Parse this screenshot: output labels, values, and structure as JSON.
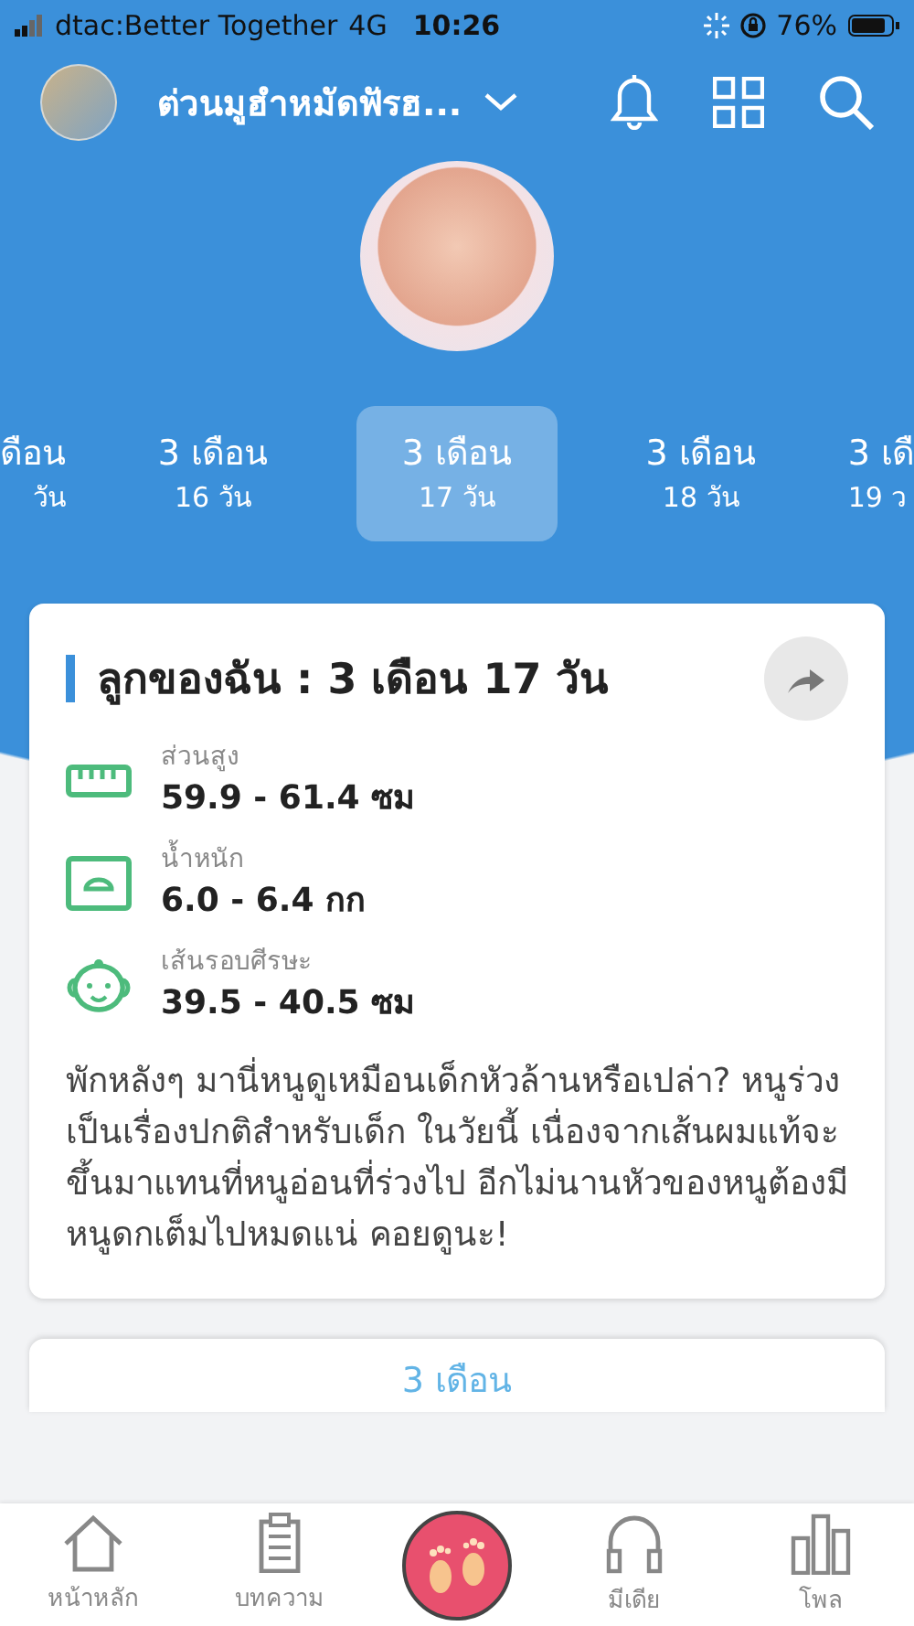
{
  "status_bar": {
    "carrier": "dtac:Better Together",
    "network": "4G",
    "time": "10:26",
    "battery": "76%"
  },
  "header": {
    "title": "ต่วนมูฮำหมัดฟัรฮ..."
  },
  "age_tabs": [
    {
      "top": "ดือน",
      "bottom": "วัน",
      "selected": false
    },
    {
      "top": "3 เดือน",
      "bottom": "16 วัน",
      "selected": false
    },
    {
      "top": "3 เดือน",
      "bottom": "17 วัน",
      "selected": true
    },
    {
      "top": "3 เดือน",
      "bottom": "18 วัน",
      "selected": false
    },
    {
      "top": "3 เดื",
      "bottom": "19 ว",
      "selected": false
    }
  ],
  "card": {
    "title": "ลูกของฉัน : 3 เดือน 17 วัน",
    "metrics": [
      {
        "label": "ส่วนสูง",
        "value": "59.9 - 61.4 ซม"
      },
      {
        "label": "น้ำหนัก",
        "value": "6.0 - 6.4 กก"
      },
      {
        "label": "เส้นรอบศีรษะ",
        "value": "39.5 - 40.5 ซม"
      }
    ],
    "text": "พักหลังๆ มานี่หนูดูเหมือนเด็กหัวล้านหรือเปล่า? หนูร่วงเป็นเรื่องปกติสำหรับเด็ก ในวัยนี้ เนื่องจากเส้นผมแท้จะขึ้นมาแทนที่หนูอ่อนที่ร่วงไป อีกไม่นานหัวของหนูต้องมีหนูดกเต็มไปหมดแน่ คอยดูนะ!"
  },
  "next_card": {
    "title": "3 เดือน"
  },
  "bottom_nav": [
    {
      "kind": "link",
      "label": "หน้าหลัก"
    },
    {
      "kind": "link",
      "label": "บทความ"
    },
    {
      "kind": "center"
    },
    {
      "kind": "link",
      "label": "มีเดีย"
    },
    {
      "kind": "link",
      "label": "โพล"
    }
  ]
}
